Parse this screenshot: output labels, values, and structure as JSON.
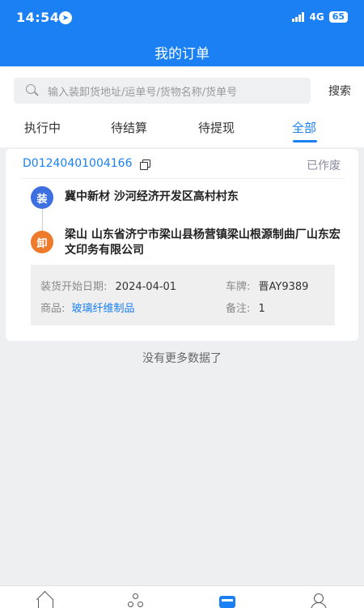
{
  "status_bar": {
    "time": "14:54",
    "network": "4G",
    "battery": "65"
  },
  "header": {
    "title": "我的订单"
  },
  "search": {
    "placeholder": "输入装卸货地址/运单号/货物名称/货单号",
    "button_label": "搜索"
  },
  "tabs": [
    {
      "label": "执行中",
      "active": false
    },
    {
      "label": "待结算",
      "active": false
    },
    {
      "label": "待提现",
      "active": false
    },
    {
      "label": "全部",
      "active": true
    }
  ],
  "orders": [
    {
      "order_no": "D01240401004166",
      "status": "已作废",
      "load_badge": "装",
      "load_address": "冀中新材  沙河经济开发区高村村东",
      "unload_badge": "卸",
      "unload_address": "梁山  山东省济宁市梁山县杨营镇梁山根源制曲厂山东宏文印务有限公司",
      "start_date_label": "装货开始日期:",
      "start_date": "2024-04-01",
      "plate_label": "车牌:",
      "plate": "晋AY9389",
      "goods_label": "商品:",
      "goods": "玻璃纤维制品",
      "remark_label": "备注:",
      "remark": "1"
    }
  ],
  "footer_text": "没有更多数据了",
  "colors": {
    "primary": "#1a80f3",
    "load_badge": "#3d6fe0",
    "unload_badge": "#ee7a2c"
  },
  "bottom_nav": [
    {
      "icon": "home-icon"
    },
    {
      "icon": "network-icon"
    },
    {
      "icon": "wallet-card-icon",
      "active": true
    },
    {
      "icon": "user-icon"
    }
  ]
}
